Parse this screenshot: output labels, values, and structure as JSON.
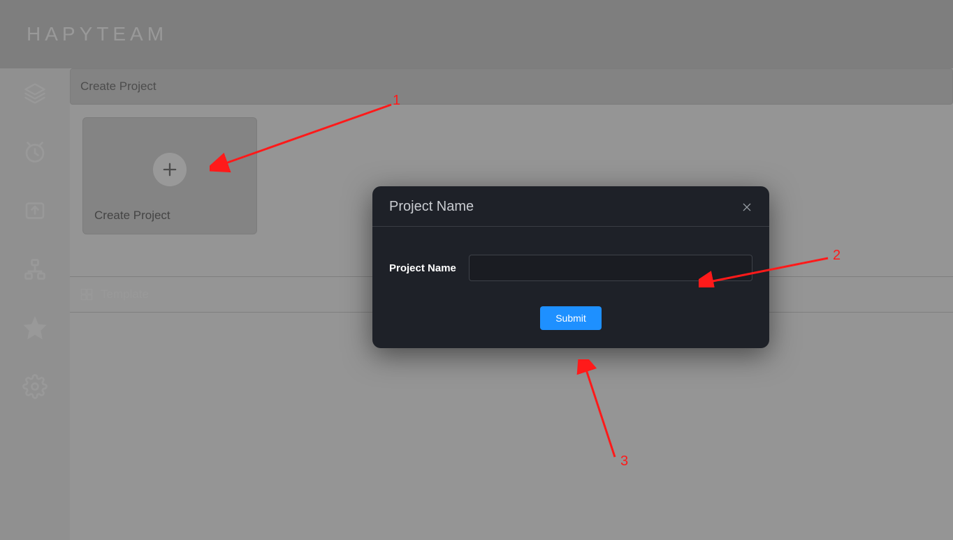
{
  "header": {
    "brand": "HAPYTEAM"
  },
  "sidebar": {
    "items": [
      {
        "icon": "layers-icon"
      },
      {
        "icon": "clock-icon"
      },
      {
        "icon": "share-icon"
      },
      {
        "icon": "org-icon"
      },
      {
        "icon": "star-icon"
      },
      {
        "icon": "gear-icon"
      }
    ]
  },
  "main": {
    "section_header": "Create Project",
    "create_card_label": "Create Project",
    "template_label": "Template"
  },
  "modal": {
    "title": "Project Name",
    "field_label": "Project Name",
    "input_value": "",
    "submit_label": "Submit"
  },
  "annotations": {
    "a1": "1",
    "a2": "2",
    "a3": "3",
    "color": "#ff1a1a"
  }
}
